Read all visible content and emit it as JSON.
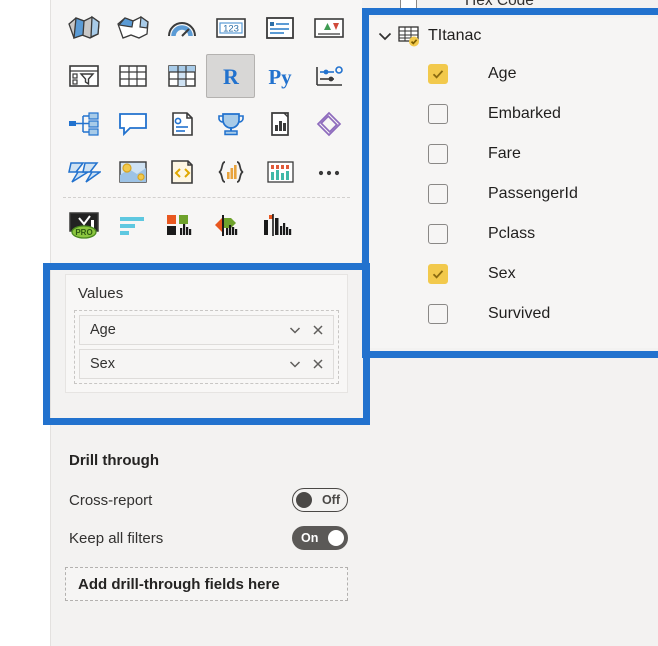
{
  "visualizations": {
    "gallery_rows": [
      [
        {
          "name": "filled-map-icon",
          "label": "Filled map"
        },
        {
          "name": "shape-map-icon",
          "label": "Shape map"
        },
        {
          "name": "gauge-icon",
          "label": "Gauge"
        },
        {
          "name": "card-icon",
          "label": "Card"
        },
        {
          "name": "multi-row-card-icon",
          "label": "Multi-row card"
        },
        {
          "name": "kpi-icon",
          "label": "KPI"
        }
      ],
      [
        {
          "name": "slicer-icon",
          "label": "Slicer"
        },
        {
          "name": "table-icon",
          "label": "Table"
        },
        {
          "name": "matrix-icon",
          "label": "Matrix"
        },
        {
          "name": "r-script-visual-icon",
          "label": "R"
        },
        {
          "name": "python-visual-icon",
          "label": "Py"
        },
        {
          "name": "key-influencers-icon",
          "label": "Key influencers"
        }
      ],
      [
        {
          "name": "decomposition-tree-icon",
          "label": "Decomposition tree"
        },
        {
          "name": "smart-narrative-icon",
          "label": "Smart narrative"
        },
        {
          "name": "metrics-icon",
          "label": "Metrics"
        },
        {
          "name": "paginated-report-icon",
          "label": "Paginated report"
        },
        {
          "name": "power-apps-icon",
          "label": "Power Apps"
        },
        {
          "name": "power-automate-icon",
          "label": "Power Automate"
        }
      ],
      [
        {
          "name": "azure-map-icon",
          "label": "Azure map"
        },
        {
          "name": "arcgis-map-icon",
          "label": "ArcGIS map"
        },
        {
          "name": "html-content-icon",
          "label": "HTML content"
        },
        {
          "name": "deneb-icon",
          "label": "Deneb"
        },
        {
          "name": "charticulator-icon",
          "label": "Charticulator"
        },
        {
          "name": "more-options-icon",
          "label": "..."
        }
      ],
      [
        {
          "name": "zoomcharts-pro-icon",
          "label": "PRO"
        },
        {
          "name": "horizontal-bar-icon",
          "label": "Horizontal bar"
        },
        {
          "name": "grouped-column-icon",
          "label": "Grouped column"
        },
        {
          "name": "funnel-compare-icon",
          "label": "Funnel compare"
        },
        {
          "name": "variance-chart-icon",
          "label": "Variance chart"
        }
      ]
    ],
    "selected": "r-script-visual-icon",
    "r_label": "R",
    "py_label": "Py",
    "pro_label": "PRO",
    "more_label": "•••"
  },
  "values_well": {
    "title": "Values",
    "chips": [
      {
        "label": "Age",
        "chevron": "chevron-down-icon",
        "remove": "close-icon"
      },
      {
        "label": "Sex",
        "chevron": "chevron-down-icon",
        "remove": "close-icon"
      }
    ]
  },
  "drill_through": {
    "heading": "Drill through",
    "cross_report": {
      "label": "Cross-report",
      "state": "Off",
      "on": false
    },
    "keep_all_filters": {
      "label": "Keep all filters",
      "state": "On",
      "on": true
    },
    "dropzone_label": "Add drill-through fields here"
  },
  "fields_pane": {
    "clipped_field": "Hex Code",
    "table": {
      "name": "TItanac",
      "chevron": "chevron-down-icon",
      "icon": "table-icon",
      "badge": "checked-badge-icon",
      "expanded": true
    },
    "fields": [
      {
        "name": "Age",
        "checked": true
      },
      {
        "name": "Embarked",
        "checked": false
      },
      {
        "name": "Fare",
        "checked": false
      },
      {
        "name": "PassengerId",
        "checked": false
      },
      {
        "name": "Pclass",
        "checked": false
      },
      {
        "name": "Sex",
        "checked": true
      },
      {
        "name": "Survived",
        "checked": false
      }
    ]
  },
  "highlights": {
    "color": "#2272CE",
    "boxes": [
      "fields-pane-highlight",
      "values-well-highlight"
    ]
  }
}
